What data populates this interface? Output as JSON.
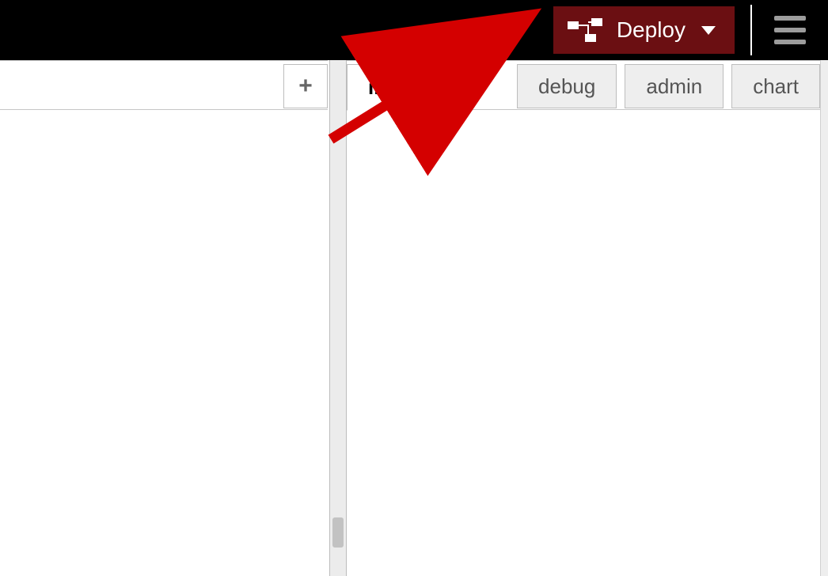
{
  "header": {
    "deploy_label": "Deploy"
  },
  "left": {
    "add_tab_glyph": "+"
  },
  "right": {
    "tabs": {
      "info": "info",
      "debug": "debug",
      "admin": "admin",
      "chart": "chart"
    }
  }
}
